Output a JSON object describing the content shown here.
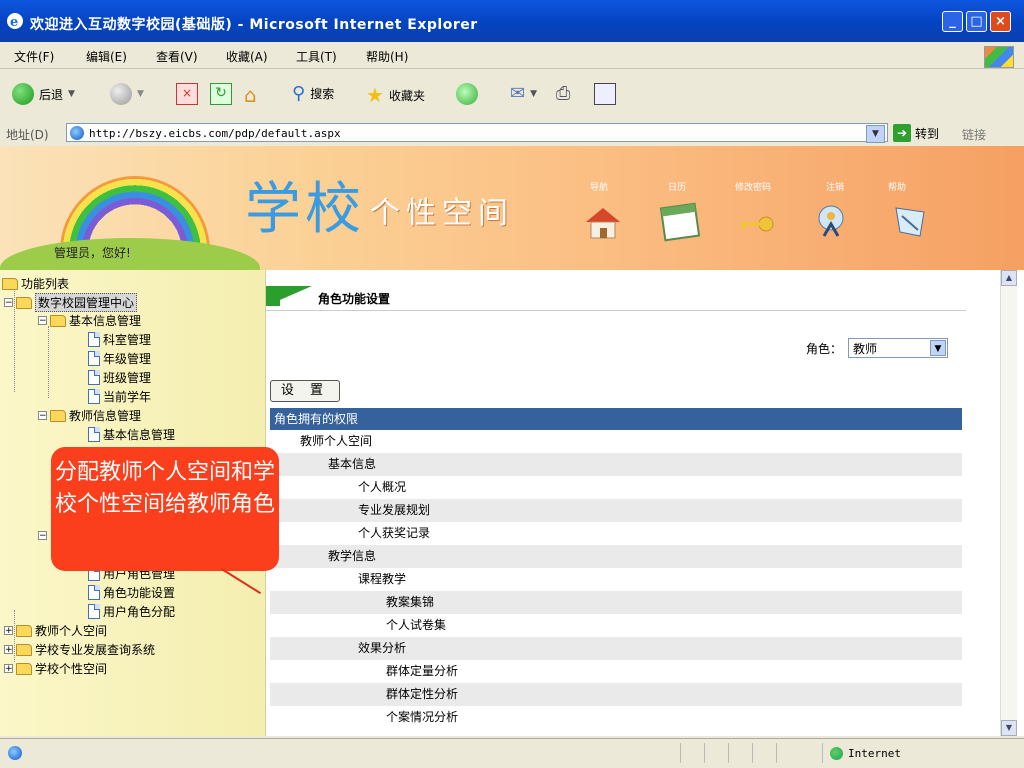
{
  "window": {
    "title": "欢迎进入互动数字校园(基础版) - Microsoft Internet Explorer"
  },
  "menu": [
    "文件(F)",
    "编辑(E)",
    "查看(V)",
    "收藏(A)",
    "工具(T)",
    "帮助(H)"
  ],
  "toolbar": {
    "back": "后退",
    "search": "搜索",
    "favorites": "收藏夹"
  },
  "address": {
    "label": "地址(D)",
    "url": "http://bszy.eicbs.com/pdp/default.aspx",
    "go": "转到",
    "links": "链接"
  },
  "banner": {
    "title_big": "学校",
    "title_small": "个性空间",
    "greeting": "管理员，您好!",
    "nav": [
      "导航",
      "日历",
      "修改密码",
      "注销",
      "帮助"
    ]
  },
  "tree": {
    "root": "功能列表",
    "n1": "数字校园管理中心",
    "n1_1": "基本信息管理",
    "n1_1_items": [
      "科室管理",
      "年级管理",
      "班级管理",
      "当前学年"
    ],
    "n1_2": "教师信息管理",
    "n1_2_items": [
      "基本信息管理"
    ],
    "n1_3_items": [
      "用户角色管理",
      "角色功能设置",
      "用户角色分配"
    ],
    "n2": "教师个人空间",
    "n3": "学校专业发展查询系统",
    "n4": "学校个性空间"
  },
  "main": {
    "section_title": "角色功能设置",
    "role_label": "角色：",
    "role_value": "教师",
    "set_button": "设 置",
    "table_header": "角色拥有的权限",
    "rows": [
      {
        "text": "教师个人空间",
        "level": 1
      },
      {
        "text": "基本信息",
        "level": 2
      },
      {
        "text": "个人概况",
        "level": 3
      },
      {
        "text": "专业发展规划",
        "level": 3
      },
      {
        "text": "个人获奖记录",
        "level": 3
      },
      {
        "text": "教学信息",
        "level": 2
      },
      {
        "text": "课程教学",
        "level": 3
      },
      {
        "text": "教案集锦",
        "level": 4
      },
      {
        "text": "个人试卷集",
        "level": 4
      },
      {
        "text": "效果分析",
        "level": 3
      },
      {
        "text": "群体定量分析",
        "level": 4
      },
      {
        "text": "群体定性分析",
        "level": 4
      },
      {
        "text": "个案情况分析",
        "level": 4
      }
    ]
  },
  "callout": {
    "text": "分配教师个人空间和学校个性空间给教师角色"
  },
  "status": {
    "zone": "Internet"
  },
  "colors": {
    "table_header": "#35629c",
    "callout": "#fb3e1c",
    "accent_green": "#2c9e2c"
  }
}
